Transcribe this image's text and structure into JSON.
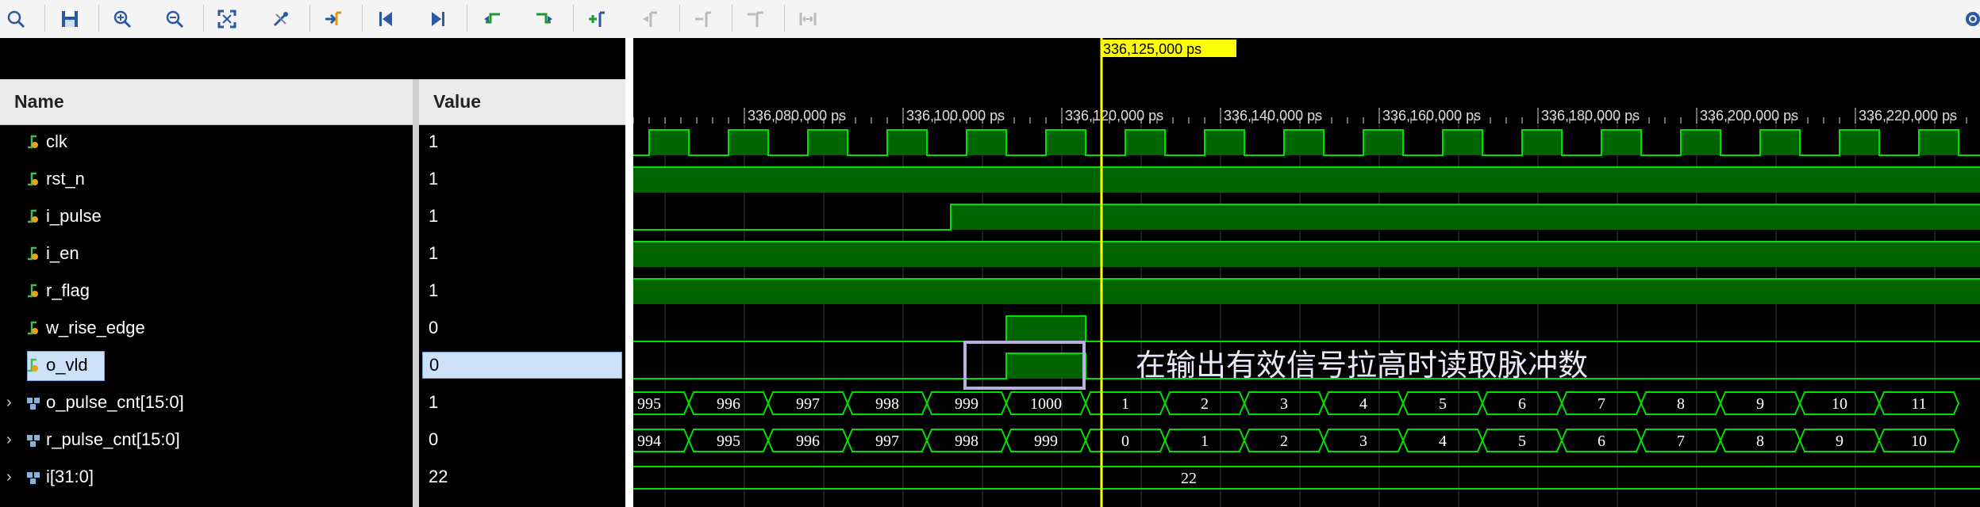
{
  "toolbar": {
    "icons": [
      "search-icon",
      "save-icon",
      "zoom-in-icon",
      "zoom-out-icon",
      "zoom-fit-icon",
      "cursor-snap-icon",
      "go-to-cursor-icon",
      "go-to-start-icon",
      "go-to-end-icon",
      "previous-transition-icon",
      "next-transition-icon",
      "add-marker-icon",
      "previous-marker-icon",
      "next-marker-icon",
      "swap-cursors-icon",
      "fix-cursor-icon",
      "settings-gear-icon"
    ]
  },
  "columns": {
    "name": "Name",
    "value": "Value"
  },
  "signals": [
    {
      "name": "clk",
      "value": "1",
      "kind": "bit"
    },
    {
      "name": "rst_n",
      "value": "1",
      "kind": "bit"
    },
    {
      "name": "i_pulse",
      "value": "1",
      "kind": "bit"
    },
    {
      "name": "i_en",
      "value": "1",
      "kind": "bit"
    },
    {
      "name": "r_flag",
      "value": "1",
      "kind": "bit"
    },
    {
      "name": "w_rise_edge",
      "value": "0",
      "kind": "bit"
    },
    {
      "name": "o_vld",
      "value": "0",
      "kind": "bit",
      "selected": true
    },
    {
      "name": "o_pulse_cnt[15:0]",
      "value": "1",
      "kind": "bus"
    },
    {
      "name": "r_pulse_cnt[15:0]",
      "value": "0",
      "kind": "bus"
    },
    {
      "name": "i[31:0]",
      "value": "22",
      "kind": "bus"
    }
  ],
  "timeline": {
    "cursor_label": "336,125,000 ps",
    "tick_labels": [
      "336,080,000 ps",
      "336,100,000 ps",
      "336,120,000 ps",
      "336,140,000 ps",
      "336,160,000 ps",
      "336,180,000 ps",
      "336,200,000 ps",
      "336,220,000 ps"
    ]
  },
  "buses": {
    "o_pulse_cnt": [
      "995",
      "996",
      "997",
      "998",
      "999",
      "1000",
      "1",
      "2",
      "3",
      "4",
      "5",
      "6",
      "7",
      "8",
      "9",
      "10",
      "11"
    ],
    "r_pulse_cnt": [
      "994",
      "995",
      "996",
      "997",
      "998",
      "999",
      "0",
      "1",
      "2",
      "3",
      "4",
      "5",
      "6",
      "7",
      "8",
      "9",
      "10"
    ],
    "i": "22"
  },
  "annotation": {
    "text": "在输出有效信号拉高时读取脉冲数"
  },
  "colors": {
    "wave": "#00e000",
    "fill": "#006400",
    "cursor": "#ffff00",
    "highlight_box": "#b8b0e0",
    "bus_text": "#ffffff"
  }
}
